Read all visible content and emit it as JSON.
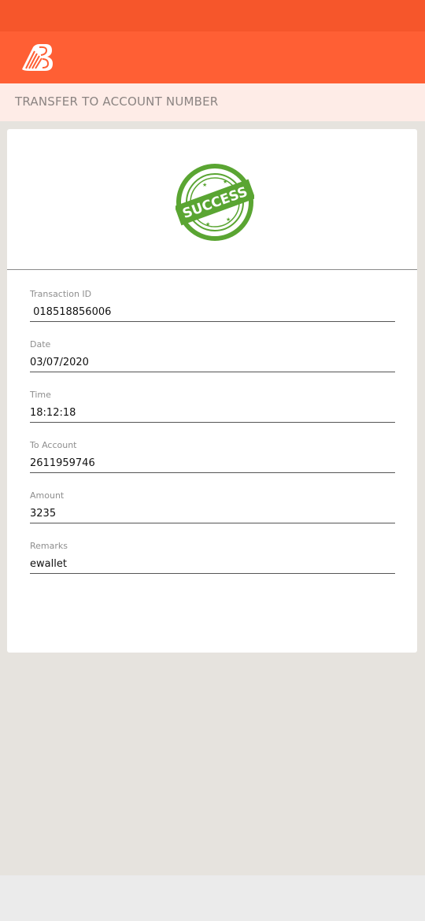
{
  "colors": {
    "status_bar": "#f6562b",
    "header": "#ff5f34",
    "sub_header_bg": "#feece7",
    "success_green": "#5aa532"
  },
  "header": {
    "logo_icon": "bank-of-baroda-logo-icon"
  },
  "sub_header": {
    "title": "TRANSFER TO ACCOUNT NUMBER"
  },
  "status": {
    "stamp_text": "SUCCESS",
    "stamp_icon": "success-stamp-icon"
  },
  "details": {
    "transaction_id": {
      "label": "Transaction ID",
      "value": " 018518856006"
    },
    "date": {
      "label": "Date",
      "value": "03/07/2020"
    },
    "time": {
      "label": "Time",
      "value": "18:12:18"
    },
    "to_account": {
      "label": "To Account",
      "value": "2611959746"
    },
    "amount": {
      "label": "Amount",
      "value": "3235"
    },
    "remarks": {
      "label": "Remarks",
      "value": "ewallet"
    }
  }
}
